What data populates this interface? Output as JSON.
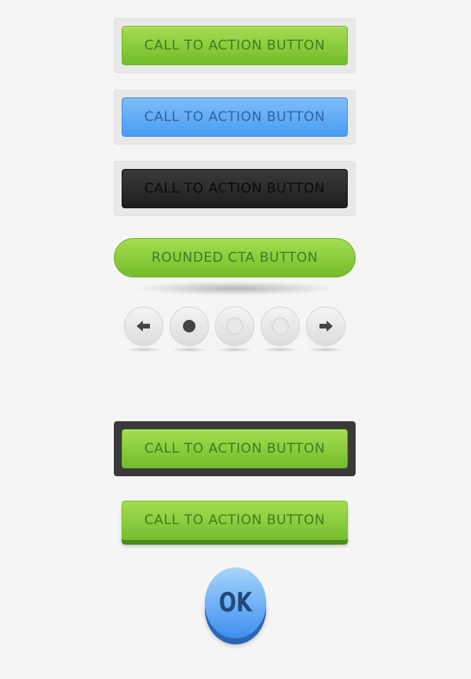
{
  "buttons": {
    "green_label": "CALL TO ACTION BUTTON",
    "blue_label": "CALL TO ACTION BUTTON",
    "black_label": "CALL TO ACTION BUTTON",
    "rounded_label": "ROUNDED CTA BUTTON",
    "dark_frame_label": "CALL TO ACTION BUTTON",
    "raised_label": "CALL TO ACTION BUTTON",
    "ok_label": "OK"
  },
  "pager": {
    "items": [
      "arrow-left-icon",
      "dot-active-icon",
      "dot-inactive-icon",
      "dot-inactive-icon",
      "arrow-right-icon"
    ],
    "active_index": 1
  },
  "colors": {
    "green": "#8ccc3e",
    "blue": "#5fabf6",
    "black": "#2a2a2a",
    "text_green": "#3f7d1b",
    "text_blue": "#2a64a6"
  }
}
